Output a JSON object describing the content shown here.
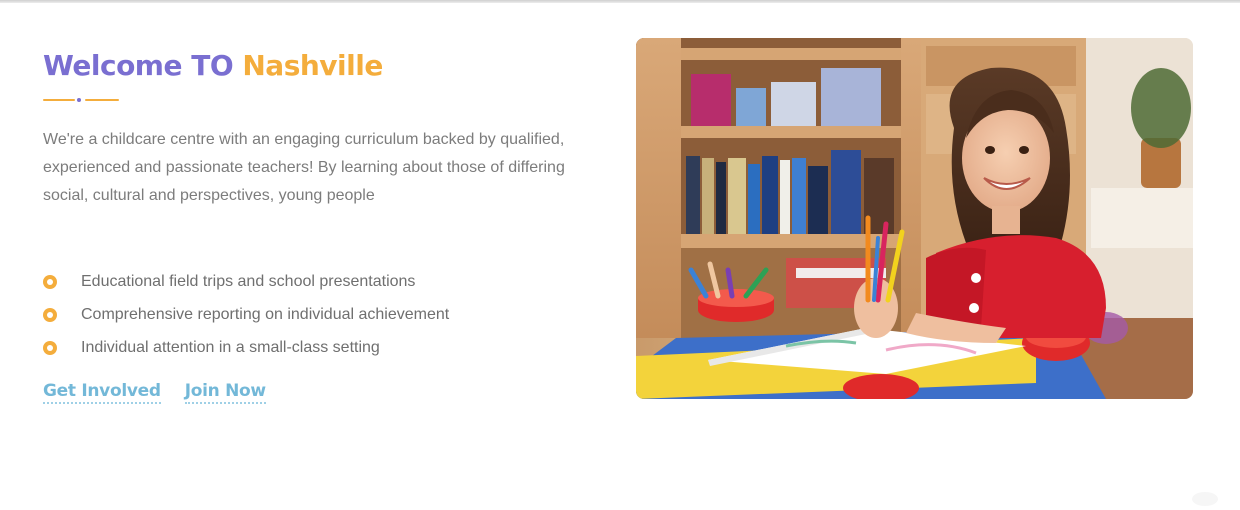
{
  "welcome": {
    "title_part1": "Welcome TO",
    "title_part2": "Nashville",
    "intro": "We're a childcare centre with an engaging curriculum backed by qualified, experienced and passionate teachers! By learning about those of differing social, cultural and perspectives, young people",
    "features": [
      "Educational field trips and school presentations",
      "Comprehensive reporting on individual achievement",
      "Individual attention in a small-class setting"
    ],
    "links": {
      "get_involved": "Get Involved",
      "join_now": "Join Now"
    }
  },
  "colors": {
    "purple": "#7a6fd1",
    "orange": "#f4ad3c",
    "link_blue": "#73b8d8",
    "body_text": "#7c7c7c"
  },
  "icons": {
    "bullet": "circle-bullet-icon"
  }
}
